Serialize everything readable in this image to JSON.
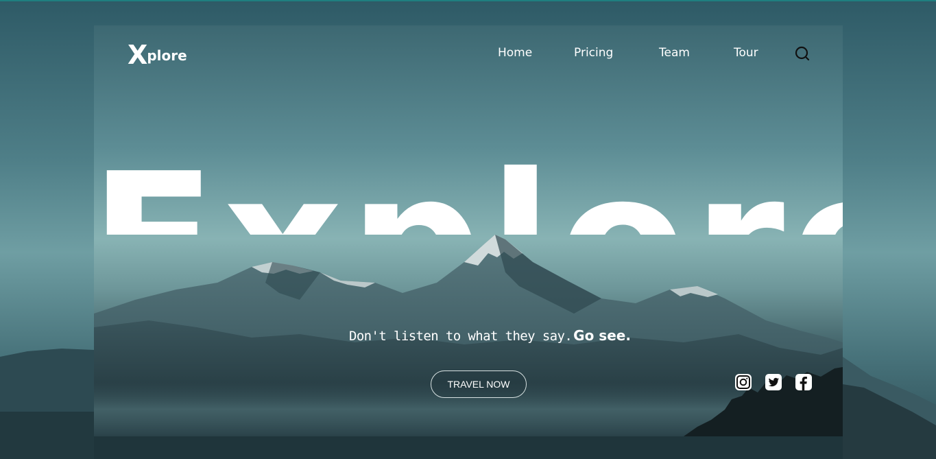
{
  "brand": {
    "logo_initial": "X",
    "logo_rest": "plore"
  },
  "nav": {
    "items": [
      {
        "label": "Home"
      },
      {
        "label": "Pricing"
      },
      {
        "label": "Team"
      },
      {
        "label": "Tour"
      }
    ],
    "search_icon": "search-icon"
  },
  "hero": {
    "headline": "Explore",
    "tagline_plain": "Don't listen to what they say.",
    "tagline_bold": "Go see.",
    "cta_label": "TRAVEL NOW"
  },
  "social": [
    {
      "name": "instagram-icon"
    },
    {
      "name": "twitter-icon"
    },
    {
      "name": "facebook-icon"
    }
  ],
  "colors": {
    "top_line": "#1f7f80",
    "text": "#ffffff",
    "search_icon": "#111111"
  }
}
